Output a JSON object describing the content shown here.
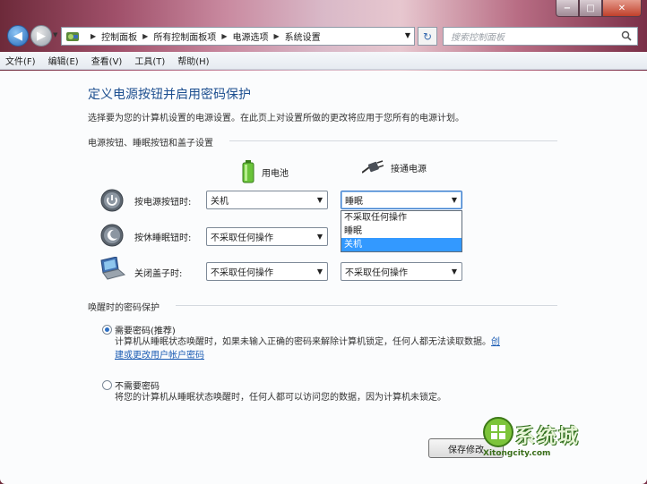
{
  "window": {
    "caption_min": "−",
    "caption_max": "□",
    "caption_close": "✕"
  },
  "address": {
    "crumbs": [
      "控制面板",
      "所有控制面板项",
      "电源选项",
      "系统设置"
    ],
    "search_placeholder": "搜索控制面板"
  },
  "menu": [
    "文件(F)",
    "编辑(E)",
    "查看(V)",
    "工具(T)",
    "帮助(H)"
  ],
  "page": {
    "title": "定义电源按钮并启用密码保护",
    "description": "选择要为您的计算机设置的电源设置。在此页上对设置所做的更改将应用于您所有的电源计划。"
  },
  "power_section": {
    "label": "电源按钮、睡眠按钮和盖子设置",
    "col_battery": "用电池",
    "col_plugged": "接通电源",
    "rows": [
      {
        "label": "按电源按钮时:",
        "battery": "关机",
        "plugged": "睡眠"
      },
      {
        "label": "按休睡眠钮时:",
        "battery": "不采取任何操作",
        "plugged": "睡眠"
      },
      {
        "label": "关闭盖子时:",
        "battery": "不采取任何操作",
        "plugged": "不采取任何操作"
      }
    ],
    "dropdown_options": [
      "不采取任何操作",
      "睡眠",
      "关机"
    ],
    "dropdown_selected": "关机"
  },
  "password_section": {
    "label": "唤醒时的密码保护",
    "require_label": "需要密码(推荐)",
    "require_desc_1": "计算机从睡眠状态唤醒时，如果未输入正确的密码来解除计算机锁定，任何人都无法读取数据。",
    "require_link_1": "创",
    "require_link_2": "建或更改用户帐户密码",
    "norequire_label": "不需要密码",
    "norequire_desc": "将您的计算机从睡眠状态唤醒时，任何人都可以访问您的数据，因为计算机未锁定。",
    "selected": "require"
  },
  "buttons": {
    "save": "保存修改"
  },
  "watermark": {
    "text": "系统城",
    "url": "Xitongcity.com"
  },
  "colors": {
    "title": "#1c4e8f",
    "highlight": "#3399ff",
    "link": "#1a5bb3"
  }
}
